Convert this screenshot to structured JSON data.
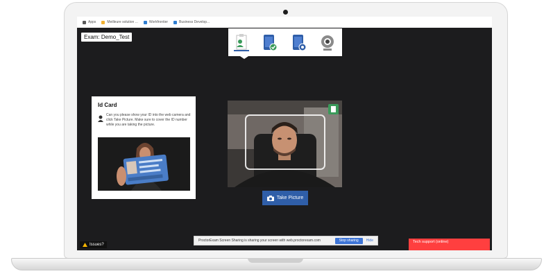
{
  "bookmarks": [
    {
      "label": "Apps",
      "icon": "apps-grid-icon",
      "color": "#5a5a5a"
    },
    {
      "label": "Meilleure solution ...",
      "icon": "bookmark-icon",
      "color": "#f2b233"
    },
    {
      "label": "Workfrontier",
      "icon": "bookmark-icon",
      "color": "#2e7dd1"
    },
    {
      "label": "Business Develop...",
      "icon": "bookmark-icon",
      "color": "#2e7dd1"
    }
  ],
  "exam": {
    "title": "Exam: Demo_Test"
  },
  "steps": [
    {
      "name": "id-card-step",
      "icon": "id-card-icon",
      "active": true
    },
    {
      "name": "tablet-check-step",
      "icon": "tablet-check-icon",
      "active": false
    },
    {
      "name": "tablet-record-step",
      "icon": "tablet-record-icon",
      "active": false
    },
    {
      "name": "webcam-step",
      "icon": "webcam-icon",
      "active": false
    }
  ],
  "id_card": {
    "title": "Id Card",
    "description": "Can you please show your ID into the web camera and click Take Picture. Make sure to cover the ID number while you are taking the picture."
  },
  "camera": {
    "take_picture": "Take Picture"
  },
  "footer": {
    "issues": "Issues?",
    "share_text": "ProctorExam Screen Sharing is sharing your screen with web.proctorexam.com",
    "stop_sharing": "Stop sharing",
    "hide": "Hide",
    "tech_support": "Tech support (online)"
  },
  "colors": {
    "accent": "#2f5ea8",
    "support": "#ff3f3f",
    "check": "#3a9a5a"
  }
}
